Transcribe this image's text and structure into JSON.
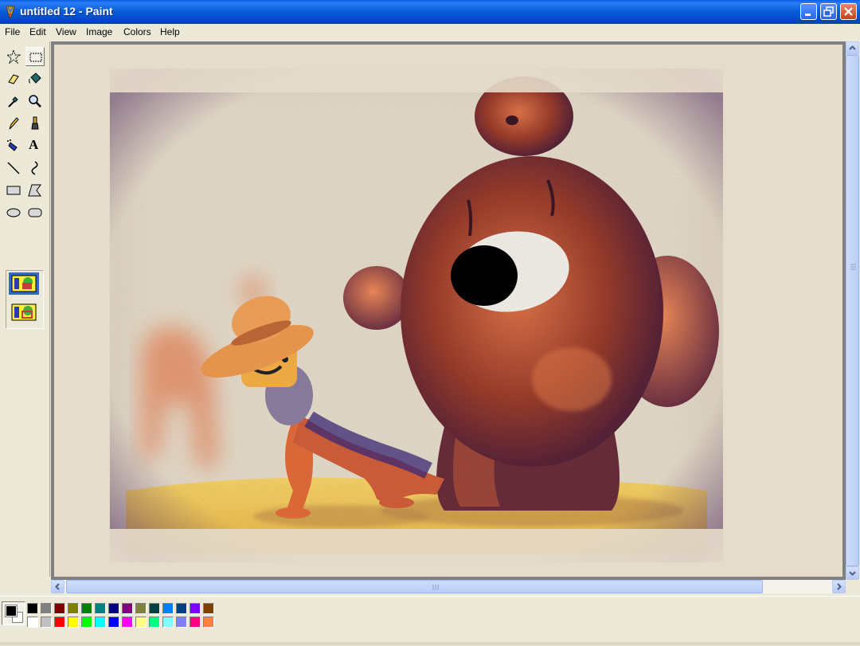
{
  "window": {
    "title": "untitled 12 - Paint"
  },
  "menu": [
    "File",
    "Edit",
    "View",
    "Image",
    "Colors",
    "Help"
  ],
  "tools": [
    {
      "name": "free-form-select-tool",
      "icon": "star-select-icon"
    },
    {
      "name": "select-tool",
      "icon": "rect-select-icon",
      "selected": true
    },
    {
      "name": "eraser-tool",
      "icon": "eraser-icon"
    },
    {
      "name": "fill-tool",
      "icon": "paint-bucket-icon"
    },
    {
      "name": "pick-color-tool",
      "icon": "eyedropper-icon"
    },
    {
      "name": "magnifier-tool",
      "icon": "magnifier-icon"
    },
    {
      "name": "pencil-tool",
      "icon": "pencil-icon"
    },
    {
      "name": "brush-tool",
      "icon": "brush-icon"
    },
    {
      "name": "airbrush-tool",
      "icon": "airbrush-icon"
    },
    {
      "name": "text-tool",
      "icon": "text-icon"
    },
    {
      "name": "line-tool",
      "icon": "line-icon"
    },
    {
      "name": "curve-tool",
      "icon": "curve-icon"
    },
    {
      "name": "rectangle-tool",
      "icon": "rectangle-icon"
    },
    {
      "name": "polygon-tool",
      "icon": "polygon-icon"
    },
    {
      "name": "ellipse-tool",
      "icon": "ellipse-icon"
    },
    {
      "name": "rounded-rectangle-tool",
      "icon": "rounded-rectangle-icon"
    }
  ],
  "tool_glyphs": {
    "text": "A"
  },
  "colors": {
    "foreground": "#000000",
    "background": "#ffffff",
    "palette_top": [
      "#000000",
      "#808080",
      "#800000",
      "#808000",
      "#008000",
      "#008080",
      "#000080",
      "#800080",
      "#808040",
      "#004040",
      "#0080ff",
      "#004080",
      "#8000ff",
      "#804000"
    ],
    "palette_bottom": [
      "#ffffff",
      "#c0c0c0",
      "#ff0000",
      "#ffff00",
      "#00ff00",
      "#00ffff",
      "#0000ff",
      "#ff00ff",
      "#ffff80",
      "#00ff80",
      "#80ffff",
      "#8080ff",
      "#ff0080",
      "#ff8040"
    ]
  }
}
